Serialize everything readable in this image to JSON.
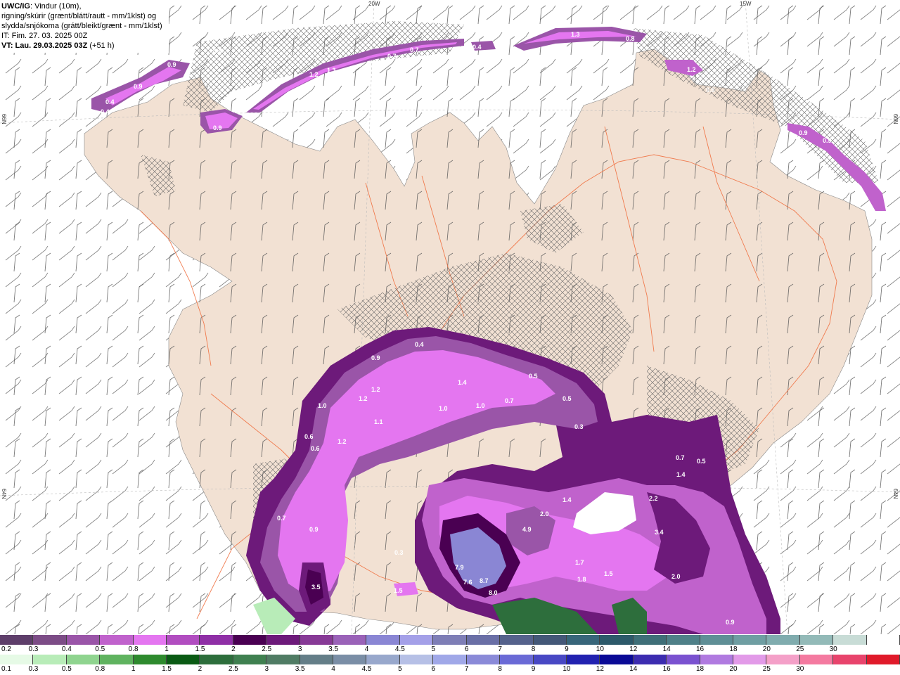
{
  "header": {
    "title_bold": "UWC/IG",
    "title_rest": ": Vindur (10m),",
    "line2": "rigning/skúrir (grænt/blátt/rautt - mm/1klst) og",
    "line3": "slydda/snjókoma (grátt/bleikt/grænt - mm/1klst)",
    "line4": "IT: Fim. 27. 03. 2025 00Z",
    "line5_bold": "VT: Lau. 29.03.2025 03Z",
    "line5_rest": " (+51 h)"
  },
  "graticule": {
    "lon_labels": [
      "20W",
      "15W"
    ],
    "lat_labels_left": [
      "66N",
      "64N"
    ],
    "lat_labels_right": [
      "66N",
      "64N"
    ]
  },
  "precip_labels": [
    {
      "v": "0.4"
    },
    {
      "v": "0.9"
    },
    {
      "v": "0.9"
    },
    {
      "v": "0.4"
    },
    {
      "v": "0.4"
    },
    {
      "v": "0.9"
    },
    {
      "v": "1.2"
    },
    {
      "v": "1.3"
    },
    {
      "v": "0.7"
    },
    {
      "v": "0.7"
    },
    {
      "v": "0.4"
    },
    {
      "v": "1.3"
    },
    {
      "v": "0.8"
    },
    {
      "v": "1.2"
    },
    {
      "v": "0.6"
    },
    {
      "v": "0.9"
    },
    {
      "v": "0.9"
    },
    {
      "v": "0.4"
    },
    {
      "v": "0.9"
    },
    {
      "v": "1.2"
    },
    {
      "v": "1.2"
    },
    {
      "v": "1.0"
    },
    {
      "v": "1.1"
    },
    {
      "v": "0.6"
    },
    {
      "v": "0.6"
    },
    {
      "v": "1.2"
    },
    {
      "v": "1.4"
    },
    {
      "v": "1.0"
    },
    {
      "v": "1.0"
    },
    {
      "v": "0.7"
    },
    {
      "v": "0.5"
    },
    {
      "v": "0.5"
    },
    {
      "v": "0.3"
    },
    {
      "v": "0.7"
    },
    {
      "v": "0.5"
    },
    {
      "v": "1.4"
    },
    {
      "v": "2.2"
    },
    {
      "v": "3.4"
    },
    {
      "v": "1.4"
    },
    {
      "v": "2.0"
    },
    {
      "v": "4.9"
    },
    {
      "v": "7.9"
    },
    {
      "v": "7.6"
    },
    {
      "v": "8.7"
    },
    {
      "v": "8.0"
    },
    {
      "v": "1.7"
    },
    {
      "v": "1.8"
    },
    {
      "v": "1.5"
    },
    {
      "v": "2.0"
    },
    {
      "v": "0.7"
    },
    {
      "v": "0.9"
    },
    {
      "v": "3.5"
    },
    {
      "v": "0.3"
    },
    {
      "v": "1.5"
    },
    {
      "v": "0.9"
    }
  ],
  "legend_snow": {
    "colors": [
      "#5e3e6a",
      "#7c4c86",
      "#9a55a8",
      "#c062cc",
      "#e476f0",
      "#b14dc0",
      "#8f2fa6",
      "#4a0052",
      "#6d1a7a",
      "#873a96",
      "#9a62b8",
      "#8a86d4",
      "#a4a0e8",
      "#7e7eb6",
      "#6a6fa6",
      "#55628c",
      "#445878",
      "#38667a",
      "#2d5a6a",
      "#3f6f78",
      "#4f8088",
      "#5f8f96",
      "#6f9ea2",
      "#80acae",
      "#93bab8",
      "#c8dcd6",
      "#ffffff"
    ],
    "labels": [
      "0.2",
      "0.3",
      "0.4",
      "0.5",
      "0.8",
      "1",
      "1.5",
      "2",
      "2.5",
      "3",
      "3.5",
      "4",
      "4.5",
      "5",
      "6",
      "7",
      "8",
      "9",
      "10",
      "12",
      "14",
      "16",
      "18",
      "20",
      "25",
      "30"
    ]
  },
  "legend_rain": {
    "colors": [
      "#e6fae6",
      "#b8ecb8",
      "#8fd48f",
      "#5fb35f",
      "#2e8a2e",
      "#0a5a14",
      "#2d6e3c",
      "#3f8050",
      "#507c64",
      "#647e88",
      "#7a8ea6",
      "#98a8cc",
      "#b6c0e6",
      "#a0a8e8",
      "#8a8ad8",
      "#6a6ad6",
      "#4848c4",
      "#2222b0",
      "#0a0a96",
      "#3c2cb0",
      "#7a52d0",
      "#b07ae0",
      "#e29ae8",
      "#f4a0c8",
      "#f47aa0",
      "#e8446c",
      "#e01a2a"
    ],
    "labels": [
      "0.1",
      "0.3",
      "0.5",
      "0.8",
      "1",
      "1.5",
      "2",
      "2.5",
      "3",
      "3.5",
      "4",
      "4.5",
      "5",
      "6",
      "7",
      "8",
      "9",
      "10",
      "12",
      "14",
      "16",
      "18",
      "20",
      "25",
      "30"
    ]
  }
}
